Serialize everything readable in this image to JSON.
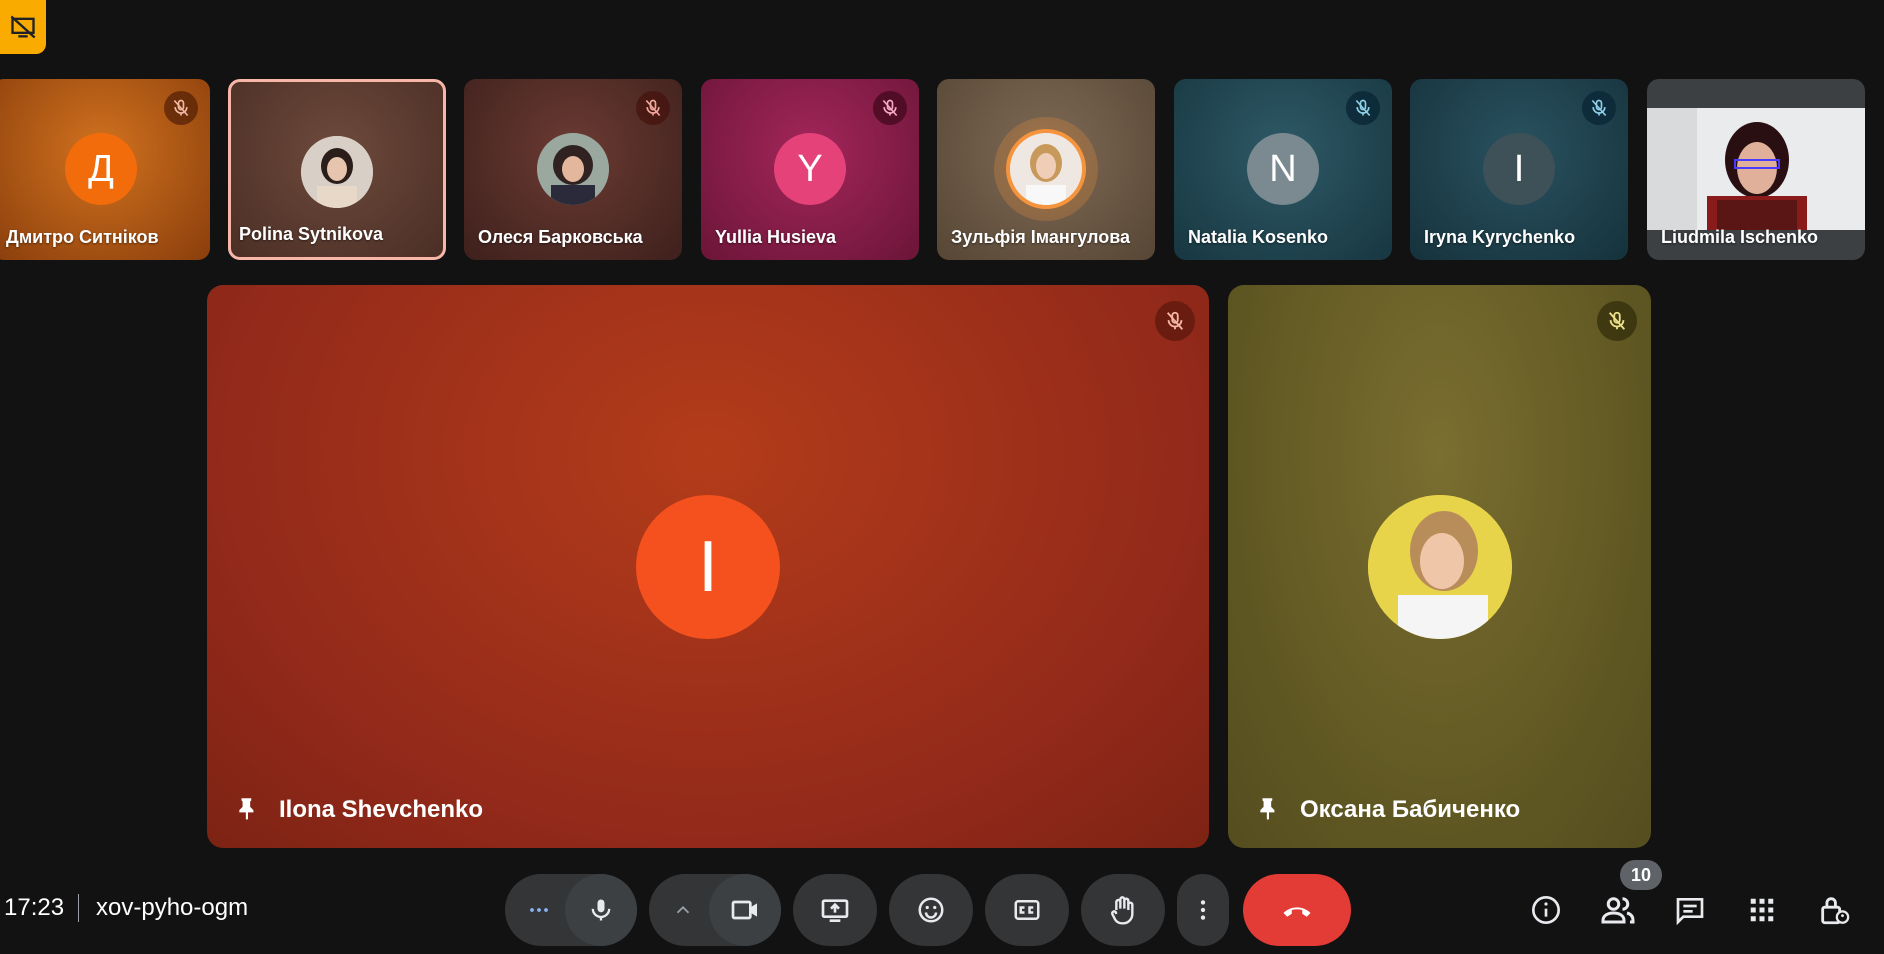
{
  "meeting": {
    "time": "17:23",
    "code": "xov-pyho-ogm",
    "participant_count": "10"
  },
  "strip": [
    {
      "name": "Дмитро Ситніков",
      "initial": "Д",
      "bg": "#b85a12",
      "avatar_color": "#f36c0b",
      "muted": true
    },
    {
      "name": "Polina Sytnikova",
      "initial": "",
      "bg": "#5a3b30",
      "avatar_color": "#c9b9a8",
      "muted": false,
      "active": true
    },
    {
      "name": "Олеся Барковська",
      "initial": "",
      "bg": "#4e2a25",
      "avatar_color": "#7d6a60",
      "muted": true
    },
    {
      "name": "Yullia Husieva",
      "initial": "Y",
      "bg": "#8a1f4a",
      "avatar_color": "#e6427a",
      "muted": true
    },
    {
      "name": "Зульфія Імангулова",
      "initial": "",
      "bg": "#6b5a48",
      "avatar_color": "#e8cdb8",
      "muted": false
    },
    {
      "name": "Natalia Kosenko",
      "initial": "N",
      "bg": "#1f4955",
      "avatar_color": "#7a8a90",
      "muted": true
    },
    {
      "name": "Iryna Kyrychenko",
      "initial": "I",
      "bg": "#1d3f4a",
      "avatar_color": "#3e5158",
      "muted": true
    },
    {
      "name": "Liudmila Ischenko",
      "initial": "",
      "bg": "#e6e6e6",
      "avatar_color": "#6b2a2a",
      "muted": false
    }
  ],
  "main": [
    {
      "name": "Ilona Shevchenko",
      "initial": "I",
      "bg": "#a83418",
      "avatar_color": "#f4511e"
    },
    {
      "name": "Оксана Бабиченко",
      "initial": "",
      "bg": "#6b6028",
      "avatar_color": "#e8d44a"
    }
  ],
  "controls": {
    "more_options_icon": "more-horiz-icon",
    "mic_icon": "mic-icon",
    "camera_icon": "videocam-icon",
    "present_icon": "present-icon",
    "emoji_icon": "emoji-icon",
    "captions_icon": "cc-icon",
    "raise_hand_icon": "hand-icon",
    "more_vert_icon": "more-vert-icon",
    "end_call_icon": "call-end-icon",
    "info_icon": "info-icon",
    "people_icon": "people-icon",
    "chat_icon": "chat-icon",
    "activities_icon": "apps-icon",
    "host_controls_icon": "lock-person-icon"
  },
  "colors": {
    "end_call": "#e33b35",
    "badge": "#f9ab00",
    "active_border": "#f8b6a8"
  }
}
